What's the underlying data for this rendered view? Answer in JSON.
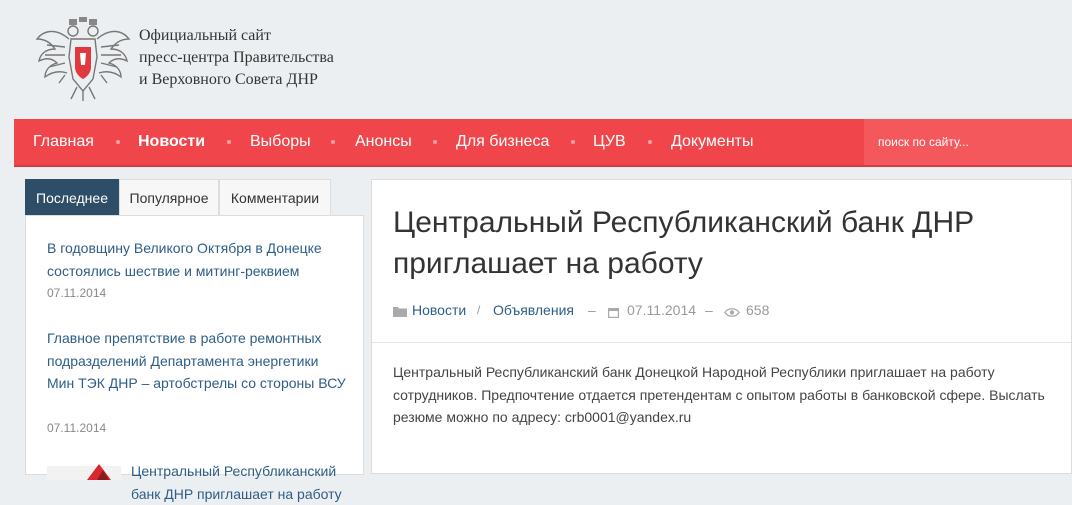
{
  "header": {
    "logo_icon": "coat-of-arms-icon",
    "title_lines": [
      "Официальный сайт",
      "пресс-центра Правительства",
      "и Верховного Совета ДНР"
    ]
  },
  "nav": {
    "items": [
      {
        "label": "Главная"
      },
      {
        "label": "Новости",
        "active": true
      },
      {
        "label": "Выборы"
      },
      {
        "label": "Анонсы"
      },
      {
        "label": "Для бизнеса"
      },
      {
        "label": "ЦУВ"
      },
      {
        "label": "Документы"
      }
    ],
    "search_placeholder": "поиск по сайту...",
    "color": "#f0464b"
  },
  "sidebar": {
    "tabs": [
      {
        "label": "Последнее",
        "active": true
      },
      {
        "label": "Популярное"
      },
      {
        "label": "Комментарии"
      }
    ],
    "items": [
      {
        "title": "В годовщину Великого Октября в Донецке состоялись шествие и митинг-реквием",
        "date": "07.11.2014"
      },
      {
        "title": "Главное препятствие в работе ремонтных подразделений Департамента энергетики Мин ТЭК ДНР – артобстрелы со стороны ВСУ",
        "date": "07.11.2014"
      },
      {
        "title": "Центральный Республиканский банк ДНР приглашает на работу",
        "date": ""
      }
    ],
    "accent": "#2e4d66"
  },
  "article": {
    "title": "Центральный Республиканский банк ДНР приглашает на работу",
    "meta": {
      "category": "Новости",
      "separator": "/",
      "subcategory": "Объявления",
      "dash": "–",
      "date": "07.11.2014",
      "views": "658",
      "folder_icon": "folder-icon",
      "calendar_icon": "calendar-icon",
      "eye_icon": "eye-icon"
    },
    "body": "Центральный Республиканский банк Донецкой Народной Республики приглашает на работу сотрудников. Предпочтение отдается претендентам с опытом работы в банковской сфере. Выслать резюме можно по адресу: crb0001@yandex.ru"
  }
}
